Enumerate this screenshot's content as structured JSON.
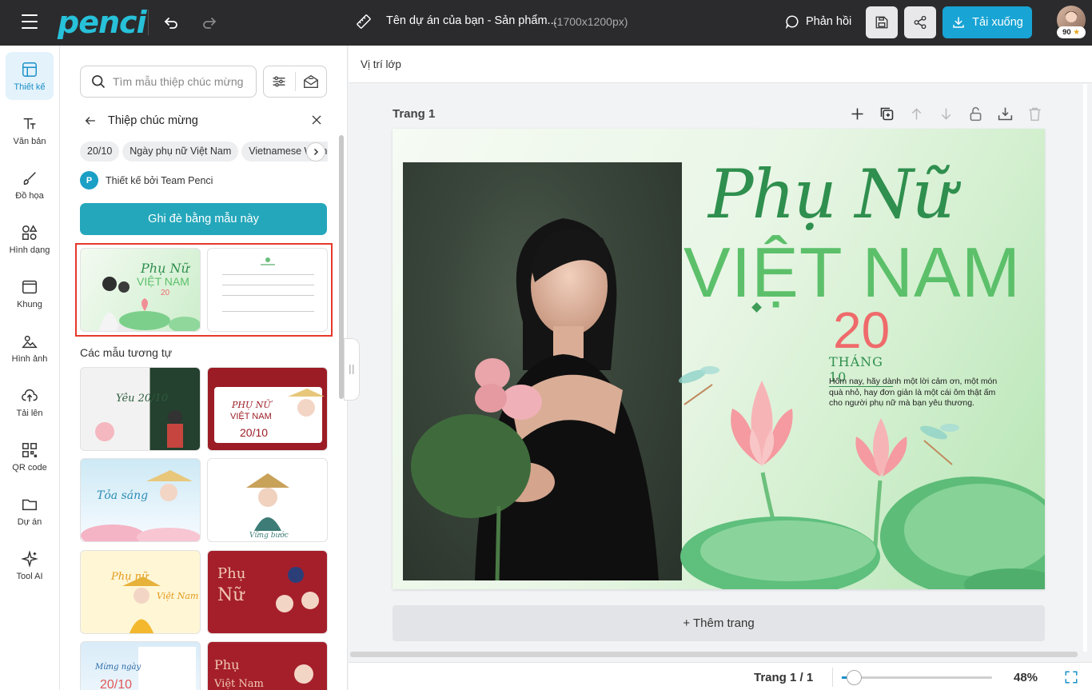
{
  "app": {
    "logo": "penci",
    "doc_title": "Tên dự án của bạn - Sản phẩm...",
    "doc_size": "(1700x1200px)",
    "feedback": "Phản hồi",
    "download": "Tải xuống",
    "avatar_badge": "90"
  },
  "rail": [
    {
      "label": "Thiết kế",
      "icon": "layout-icon"
    },
    {
      "label": "Văn bản",
      "icon": "text-icon"
    },
    {
      "label": "Đồ họa",
      "icon": "brush-icon"
    },
    {
      "label": "Hình dạng",
      "icon": "shapes-icon"
    },
    {
      "label": "Khung",
      "icon": "frame-icon"
    },
    {
      "label": "Hình ảnh",
      "icon": "image-icon"
    },
    {
      "label": "Tải lên",
      "icon": "upload-icon"
    },
    {
      "label": "QR code",
      "icon": "qr-icon"
    },
    {
      "label": "Dự án",
      "icon": "folder-icon"
    },
    {
      "label": "Tool AI",
      "icon": "sparkle-icon"
    }
  ],
  "panel": {
    "search_placeholder": "Tìm mẫu thiệp chúc mừng",
    "back_title": "Thiệp chúc mừng",
    "chips": [
      "20/10",
      "Ngày phụ nữ Việt Nam",
      "Vietnamese Women"
    ],
    "designer": "Thiết kế bởi Team Penci",
    "designer_initial": "P",
    "apply_button": "Ghi đè bằng mẫu này",
    "similar_title": "Các mẫu tương tự"
  },
  "main": {
    "layer_label": "Vị trí lớp",
    "page_label": "Trang 1",
    "add_page": "+ Thêm trang",
    "page_count": "Trang 1 / 1",
    "zoom": "48%",
    "zoom_fraction": 0.08
  },
  "card": {
    "script_title": "Phụ Nữ",
    "big_title": "VIỆT NAM",
    "number": "20",
    "month": "THÁNG 10",
    "greeting": "Hôm nay, hãy dành một lời cảm ơn, một món quà nhỏ, hay đơn giản là một cái ôm thật ấm cho người phụ nữ mà bạn yêu thương."
  },
  "colors": {
    "topbar": "#2b2b2d",
    "accent": "#18a4d4",
    "apply": "#24a7bb",
    "selection": "#e6392b",
    "card_green": "#2f8f4e",
    "card_pink": "#ef6b6b"
  }
}
